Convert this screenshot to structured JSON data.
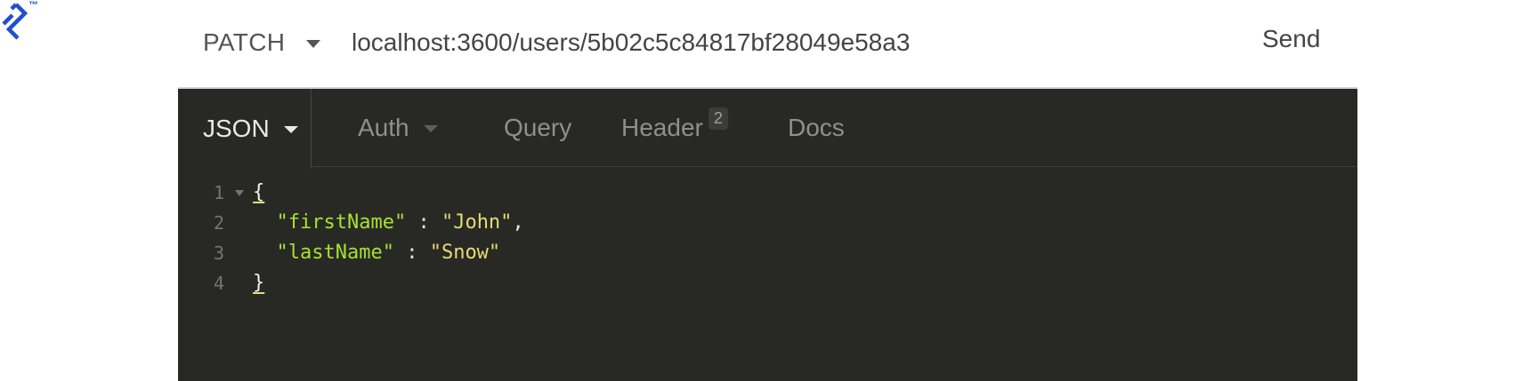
{
  "request": {
    "method": "PATCH",
    "url": "localhost:3600/users/5b02c5c84817bf28049e58a3",
    "send_label": "Send"
  },
  "tabs": [
    {
      "label": "JSON",
      "active": true,
      "dropdown": true
    },
    {
      "label": "Auth",
      "active": false,
      "dropdown": true
    },
    {
      "label": "Query",
      "active": false
    },
    {
      "label": "Header",
      "active": false,
      "badge": "2"
    },
    {
      "label": "Docs",
      "active": false
    }
  ],
  "editor": {
    "lines": [
      {
        "number": "1",
        "open_brace": "{"
      },
      {
        "number": "2",
        "key": "\"firstName\"",
        "sep": " : ",
        "value": "\"John\"",
        "trail": ","
      },
      {
        "number": "3",
        "key": "\"lastName\"",
        "sep": " : ",
        "value": "\"Snow\"",
        "trail": ""
      },
      {
        "number": "4",
        "close_brace": "}"
      }
    ]
  },
  "colors": {
    "brand": "#204ecf",
    "editor_bg": "#282925",
    "json_key": "#a6e22e",
    "json_string": "#e6db74"
  },
  "icons": {
    "logo": "toptal-logo-icon",
    "method_dropdown": "chevron-down-icon",
    "fold": "fold-arrow-icon"
  }
}
